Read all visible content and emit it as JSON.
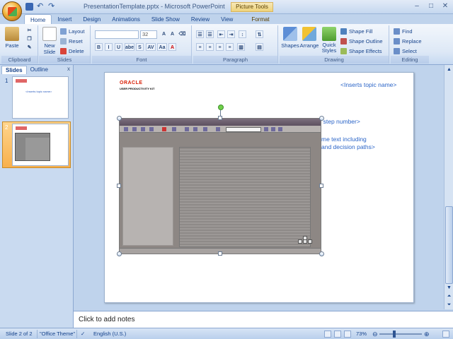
{
  "window": {
    "title": "PresentationTemplate.pptx - Microsoft PowerPoint",
    "contextual_tab_group": "Picture Tools",
    "controls": [
      "minimize",
      "maximize",
      "close"
    ]
  },
  "tabs": [
    {
      "label": "Home",
      "active": true
    },
    {
      "label": "Insert"
    },
    {
      "label": "Design"
    },
    {
      "label": "Animations"
    },
    {
      "label": "Slide Show"
    },
    {
      "label": "Review"
    },
    {
      "label": "View"
    },
    {
      "label": "Format",
      "contextual": true
    }
  ],
  "ribbon": {
    "clipboard": {
      "label": "Clipboard",
      "paste": "Paste"
    },
    "slides": {
      "label": "Slides",
      "new_slide": "New Slide",
      "layout": "Layout",
      "reset": "Reset",
      "delete": "Delete"
    },
    "font": {
      "label": "Font",
      "size": "32",
      "buttons": [
        "B",
        "I",
        "U",
        "abe",
        "S",
        "AV",
        "Aa",
        "A"
      ]
    },
    "paragraph": {
      "label": "Paragraph"
    },
    "drawing": {
      "label": "Drawing",
      "shapes": "Shapes",
      "arrange": "Arrange",
      "quick_styles": "Quick Styles",
      "shape_fill": "Shape Fill",
      "shape_outline": "Shape Outline",
      "shape_effects": "Shape Effects"
    },
    "editing": {
      "label": "Editing",
      "find": "Find",
      "replace": "Replace",
      "select": "Select"
    }
  },
  "left_pane": {
    "tabs": [
      "Slides",
      "Outline"
    ],
    "close": "x",
    "slides": [
      {
        "number": "1",
        "thumb_text": "<Inserts topic name>"
      },
      {
        "number": "2",
        "selected": true
      }
    ]
  },
  "slide": {
    "logo_brand": "ORACLE",
    "logo_sub": "USER PRODUCTIVITY KIT",
    "topic_placeholder": "<Inserts topic name>",
    "step_placeholder": "s step number>",
    "body_line1": "me text including",
    "body_line2": "and decision paths>"
  },
  "notes": {
    "placeholder": "Click to add notes"
  },
  "status_bar": {
    "slide_info": "Slide 2 of 2",
    "theme": "\"Office Theme\"",
    "language": "English (U.S.)",
    "zoom": "73%"
  }
}
